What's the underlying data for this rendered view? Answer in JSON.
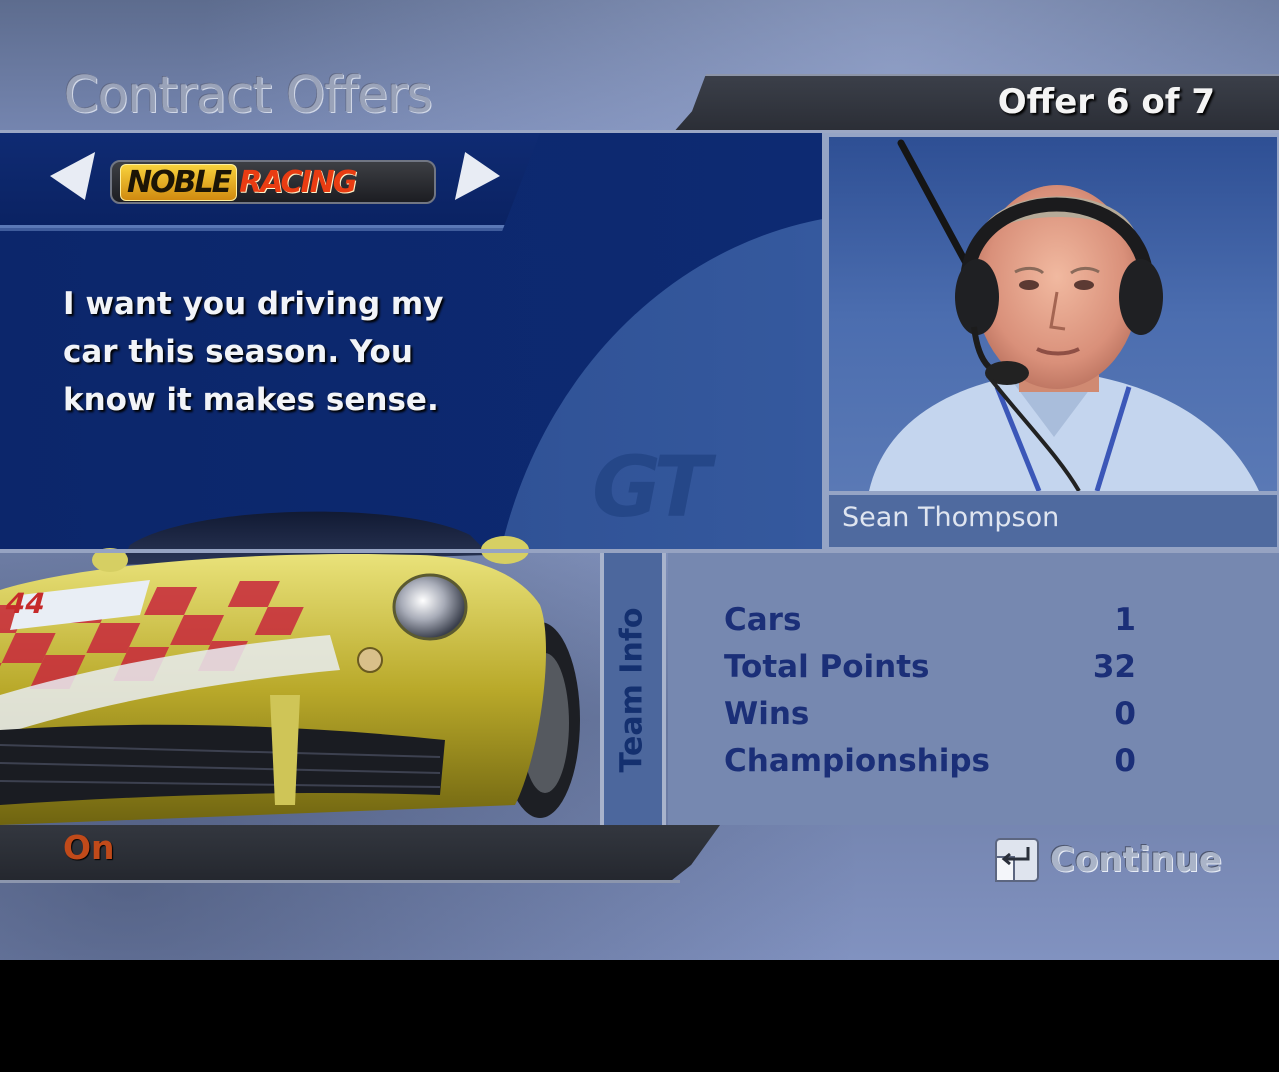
{
  "screen": {
    "title": "Contract Offers",
    "offer_counter": "Offer 6 of 7"
  },
  "team": {
    "logo_word1": "NOBLE",
    "logo_word2": "RACING",
    "quote": "I want you driving my car this season. You know it makes sense.",
    "watermark": "GT",
    "car_number": "44"
  },
  "manager": {
    "name": "Sean Thompson"
  },
  "team_info": {
    "label": "Team Info",
    "stats": [
      {
        "label": "Cars",
        "value": "1"
      },
      {
        "label": "Total Points",
        "value": "32"
      },
      {
        "label": "Wins",
        "value": "0"
      },
      {
        "label": "Championships",
        "value": "0"
      }
    ]
  },
  "footer": {
    "status": "On",
    "continue_label": "Continue"
  },
  "colors": {
    "panel_navy": "#0d2a72",
    "panel_mid_blue": "#35599e",
    "stats_bg": "#7688b0",
    "stats_text": "#1b2f78",
    "status_red": "#c04a1a"
  }
}
